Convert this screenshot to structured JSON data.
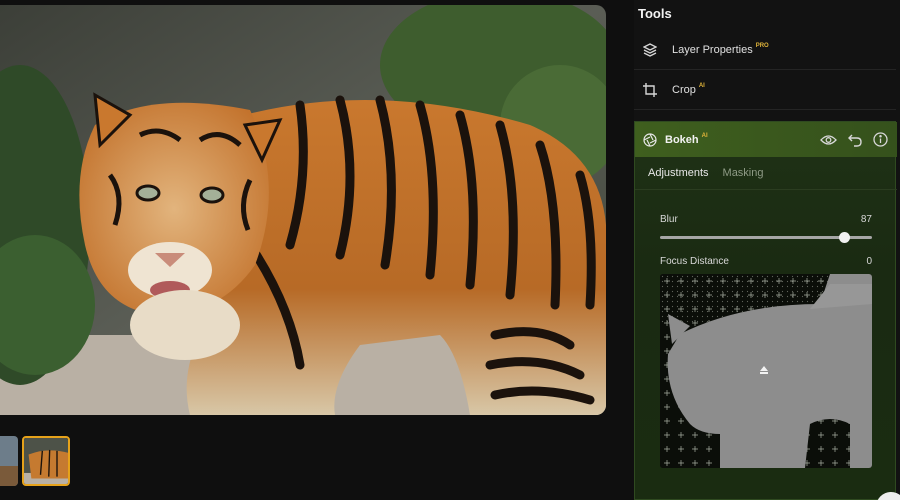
{
  "panel": {
    "title": "Tools",
    "tools": [
      {
        "label": "Layer Properties",
        "badge": "PRO",
        "icon": "layers-icon"
      },
      {
        "label": "Crop",
        "badge": "AI",
        "icon": "crop-icon"
      }
    ],
    "bokeh": {
      "label": "Bokeh",
      "badge": "AI",
      "icon": "aperture-icon",
      "actions": [
        "eye-icon",
        "undo-icon",
        "info-icon"
      ],
      "tabs": [
        {
          "label": "Adjustments",
          "active": true
        },
        {
          "label": "Masking",
          "active": false
        }
      ],
      "params": {
        "blur": {
          "label": "Blur",
          "value": "87",
          "level": 87,
          "max": 100
        },
        "focus": {
          "label": "Focus Distance",
          "value": "0"
        }
      }
    }
  },
  "colors": {
    "accent": "#e6a21a",
    "bokeh_header": "#3f5f1e",
    "panel_bg": "#121212"
  }
}
